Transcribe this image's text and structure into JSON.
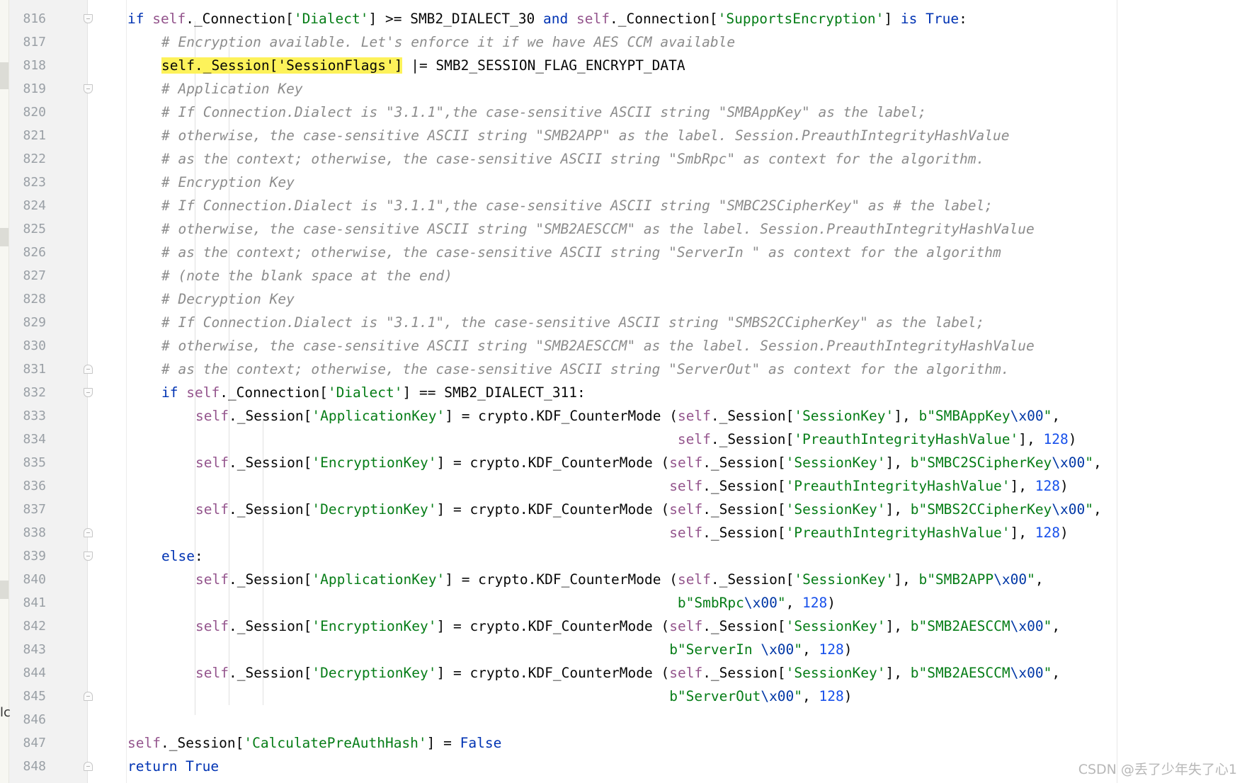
{
  "editor": {
    "watermark": "CSDN @丢了少年失了心1",
    "cut_text": "lc",
    "lines": [
      {
        "num": "816",
        "fold": "open",
        "indent": 1,
        "segs": [
          {
            "t": "kw",
            "v": "if "
          },
          {
            "t": "self",
            "v": "self"
          },
          {
            "t": "pl",
            "v": "._Connection["
          },
          {
            "t": "str",
            "v": "'Dialect'"
          },
          {
            "t": "pl",
            "v": "] >= SMB2_DIALECT_30 "
          },
          {
            "t": "kw",
            "v": "and "
          },
          {
            "t": "self",
            "v": "self"
          },
          {
            "t": "pl",
            "v": "._Connection["
          },
          {
            "t": "str",
            "v": "'SupportsEncryption'"
          },
          {
            "t": "pl",
            "v": "] "
          },
          {
            "t": "kw",
            "v": "is True"
          },
          {
            "t": "pl",
            "v": ":"
          }
        ]
      },
      {
        "num": "817",
        "fold": "",
        "indent": 2,
        "segs": [
          {
            "t": "cm",
            "v": "# Encryption available. Let's enforce it if we have AES CCM available"
          }
        ]
      },
      {
        "num": "818",
        "fold": "",
        "indent": 2,
        "segs": [
          {
            "t": "hl",
            "v": "self._Session['SessionFlags']"
          },
          {
            "t": "pl",
            "v": " |= SMB2_SESSION_FLAG_ENCRYPT_DATA"
          }
        ]
      },
      {
        "num": "819",
        "fold": "open",
        "indent": 2,
        "segs": [
          {
            "t": "cm",
            "v": "# Application Key"
          }
        ]
      },
      {
        "num": "820",
        "fold": "",
        "indent": 2,
        "segs": [
          {
            "t": "cm",
            "v": "# If Connection.Dialect is \"3.1.1\",the case-sensitive ASCII string \"SMBAppKey\" as the label;"
          }
        ]
      },
      {
        "num": "821",
        "fold": "",
        "indent": 2,
        "segs": [
          {
            "t": "cm",
            "v": "# otherwise, the case-sensitive ASCII string \"SMB2APP\" as the label. Session.PreauthIntegrityHashValue"
          }
        ]
      },
      {
        "num": "822",
        "fold": "",
        "indent": 2,
        "segs": [
          {
            "t": "cm",
            "v": "# as the context; otherwise, the case-sensitive ASCII string \"SmbRpc\" as context for the algorithm."
          }
        ]
      },
      {
        "num": "823",
        "fold": "",
        "indent": 2,
        "segs": [
          {
            "t": "cm",
            "v": "# Encryption Key"
          }
        ]
      },
      {
        "num": "824",
        "fold": "",
        "indent": 2,
        "segs": [
          {
            "t": "cm",
            "v": "# If Connection.Dialect is \"3.1.1\",the case-sensitive ASCII string \"SMBC2SCipherKey\" as # the label;"
          }
        ]
      },
      {
        "num": "825",
        "fold": "",
        "indent": 2,
        "segs": [
          {
            "t": "cm",
            "v": "# otherwise, the case-sensitive ASCII string \"SMB2AESCCM\" as the label. Session.PreauthIntegrityHashValue"
          }
        ]
      },
      {
        "num": "826",
        "fold": "",
        "indent": 2,
        "segs": [
          {
            "t": "cm",
            "v": "# as the context; otherwise, the case-sensitive ASCII string \"ServerIn \" as context for the algorithm"
          }
        ]
      },
      {
        "num": "827",
        "fold": "",
        "indent": 2,
        "segs": [
          {
            "t": "cm",
            "v": "# (note the blank space at the end)"
          }
        ]
      },
      {
        "num": "828",
        "fold": "",
        "indent": 2,
        "segs": [
          {
            "t": "cm",
            "v": "# Decryption Key"
          }
        ]
      },
      {
        "num": "829",
        "fold": "",
        "indent": 2,
        "segs": [
          {
            "t": "cm",
            "v": "# If Connection.Dialect is \"3.1.1\", the case-sensitive ASCII string \"SMBS2CCipherKey\" as the label;"
          }
        ]
      },
      {
        "num": "830",
        "fold": "",
        "indent": 2,
        "segs": [
          {
            "t": "cm",
            "v": "# otherwise, the case-sensitive ASCII string \"SMB2AESCCM\" as the label. Session.PreauthIntegrityHashValue"
          }
        ]
      },
      {
        "num": "831",
        "fold": "end",
        "indent": 2,
        "segs": [
          {
            "t": "cm",
            "v": "# as the context; otherwise, the case-sensitive ASCII string \"ServerOut\" as context for the algorithm."
          }
        ]
      },
      {
        "num": "832",
        "fold": "open",
        "indent": 2,
        "segs": [
          {
            "t": "kw",
            "v": "if "
          },
          {
            "t": "self",
            "v": "self"
          },
          {
            "t": "pl",
            "v": "._Connection["
          },
          {
            "t": "str",
            "v": "'Dialect'"
          },
          {
            "t": "pl",
            "v": "] == SMB2_DIALECT_311:"
          }
        ]
      },
      {
        "num": "833",
        "fold": "",
        "indent": 3,
        "segs": [
          {
            "t": "self",
            "v": "self"
          },
          {
            "t": "pl",
            "v": "._Session["
          },
          {
            "t": "str",
            "v": "'ApplicationKey'"
          },
          {
            "t": "pl",
            "v": "] = crypto.KDF_CounterMode ("
          },
          {
            "t": "self",
            "v": "self"
          },
          {
            "t": "pl",
            "v": "._Session["
          },
          {
            "t": "str",
            "v": "'SessionKey'"
          },
          {
            "t": "pl",
            "v": "], "
          },
          {
            "t": "str",
            "v": "b\"SMBAppKey"
          },
          {
            "t": "esc",
            "v": "\\x00"
          },
          {
            "t": "str",
            "v": "\""
          },
          {
            "t": "pl",
            "v": ","
          }
        ]
      },
      {
        "num": "834",
        "fold": "",
        "indent": 3,
        "segs": [
          {
            "t": "pl",
            "v": "                                                          "
          },
          {
            "t": "self",
            "v": "self"
          },
          {
            "t": "pl",
            "v": "._Session["
          },
          {
            "t": "str",
            "v": "'PreauthIntegrityHashValue'"
          },
          {
            "t": "pl",
            "v": "], "
          },
          {
            "t": "num",
            "v": "128"
          },
          {
            "t": "pl",
            "v": ")"
          }
        ]
      },
      {
        "num": "835",
        "fold": "",
        "indent": 3,
        "segs": [
          {
            "t": "self",
            "v": "self"
          },
          {
            "t": "pl",
            "v": "._Session["
          },
          {
            "t": "str",
            "v": "'EncryptionKey'"
          },
          {
            "t": "pl",
            "v": "] = crypto.KDF_CounterMode ("
          },
          {
            "t": "self",
            "v": "self"
          },
          {
            "t": "pl",
            "v": "._Session["
          },
          {
            "t": "str",
            "v": "'SessionKey'"
          },
          {
            "t": "pl",
            "v": "], "
          },
          {
            "t": "str",
            "v": "b\"SMBC2SCipherKey"
          },
          {
            "t": "esc",
            "v": "\\x00"
          },
          {
            "t": "str",
            "v": "\""
          },
          {
            "t": "pl",
            "v": ","
          }
        ]
      },
      {
        "num": "836",
        "fold": "",
        "indent": 3,
        "segs": [
          {
            "t": "pl",
            "v": "                                                         "
          },
          {
            "t": "self",
            "v": "self"
          },
          {
            "t": "pl",
            "v": "._Session["
          },
          {
            "t": "str",
            "v": "'PreauthIntegrityHashValue'"
          },
          {
            "t": "pl",
            "v": "], "
          },
          {
            "t": "num",
            "v": "128"
          },
          {
            "t": "pl",
            "v": ")"
          }
        ]
      },
      {
        "num": "837",
        "fold": "",
        "indent": 3,
        "segs": [
          {
            "t": "self",
            "v": "self"
          },
          {
            "t": "pl",
            "v": "._Session["
          },
          {
            "t": "str",
            "v": "'DecryptionKey'"
          },
          {
            "t": "pl",
            "v": "] = crypto.KDF_CounterMode ("
          },
          {
            "t": "self",
            "v": "self"
          },
          {
            "t": "pl",
            "v": "._Session["
          },
          {
            "t": "str",
            "v": "'SessionKey'"
          },
          {
            "t": "pl",
            "v": "], "
          },
          {
            "t": "str",
            "v": "b\"SMBS2CCipherKey"
          },
          {
            "t": "esc",
            "v": "\\x00"
          },
          {
            "t": "str",
            "v": "\""
          },
          {
            "t": "pl",
            "v": ","
          }
        ]
      },
      {
        "num": "838",
        "fold": "end",
        "indent": 3,
        "segs": [
          {
            "t": "pl",
            "v": "                                                         "
          },
          {
            "t": "self",
            "v": "self"
          },
          {
            "t": "pl",
            "v": "._Session["
          },
          {
            "t": "str",
            "v": "'PreauthIntegrityHashValue'"
          },
          {
            "t": "pl",
            "v": "], "
          },
          {
            "t": "num",
            "v": "128"
          },
          {
            "t": "pl",
            "v": ")"
          }
        ]
      },
      {
        "num": "839",
        "fold": "open",
        "indent": 2,
        "segs": [
          {
            "t": "kw",
            "v": "else"
          },
          {
            "t": "pl",
            "v": ":"
          }
        ]
      },
      {
        "num": "840",
        "fold": "",
        "indent": 3,
        "segs": [
          {
            "t": "self",
            "v": "self"
          },
          {
            "t": "pl",
            "v": "._Session["
          },
          {
            "t": "str",
            "v": "'ApplicationKey'"
          },
          {
            "t": "pl",
            "v": "] = crypto.KDF_CounterMode ("
          },
          {
            "t": "self",
            "v": "self"
          },
          {
            "t": "pl",
            "v": "._Session["
          },
          {
            "t": "str",
            "v": "'SessionKey'"
          },
          {
            "t": "pl",
            "v": "], "
          },
          {
            "t": "str",
            "v": "b\"SMB2APP"
          },
          {
            "t": "esc",
            "v": "\\x00"
          },
          {
            "t": "str",
            "v": "\""
          },
          {
            "t": "pl",
            "v": ","
          }
        ]
      },
      {
        "num": "841",
        "fold": "",
        "indent": 3,
        "segs": [
          {
            "t": "pl",
            "v": "                                                          "
          },
          {
            "t": "str",
            "v": "b\"SmbRpc"
          },
          {
            "t": "esc",
            "v": "\\x00"
          },
          {
            "t": "str",
            "v": "\""
          },
          {
            "t": "pl",
            "v": ", "
          },
          {
            "t": "num",
            "v": "128"
          },
          {
            "t": "pl",
            "v": ")"
          }
        ]
      },
      {
        "num": "842",
        "fold": "",
        "indent": 3,
        "segs": [
          {
            "t": "self",
            "v": "self"
          },
          {
            "t": "pl",
            "v": "._Session["
          },
          {
            "t": "str",
            "v": "'EncryptionKey'"
          },
          {
            "t": "pl",
            "v": "] = crypto.KDF_CounterMode ("
          },
          {
            "t": "self",
            "v": "self"
          },
          {
            "t": "pl",
            "v": "._Session["
          },
          {
            "t": "str",
            "v": "'SessionKey'"
          },
          {
            "t": "pl",
            "v": "], "
          },
          {
            "t": "str",
            "v": "b\"SMB2AESCCM"
          },
          {
            "t": "esc",
            "v": "\\x00"
          },
          {
            "t": "str",
            "v": "\""
          },
          {
            "t": "pl",
            "v": ","
          }
        ]
      },
      {
        "num": "843",
        "fold": "",
        "indent": 3,
        "segs": [
          {
            "t": "pl",
            "v": "                                                         "
          },
          {
            "t": "str",
            "v": "b\"ServerIn "
          },
          {
            "t": "esc",
            "v": "\\x00"
          },
          {
            "t": "str",
            "v": "\""
          },
          {
            "t": "pl",
            "v": ", "
          },
          {
            "t": "num",
            "v": "128"
          },
          {
            "t": "pl",
            "v": ")"
          }
        ]
      },
      {
        "num": "844",
        "fold": "",
        "indent": 3,
        "segs": [
          {
            "t": "self",
            "v": "self"
          },
          {
            "t": "pl",
            "v": "._Session["
          },
          {
            "t": "str",
            "v": "'DecryptionKey'"
          },
          {
            "t": "pl",
            "v": "] = crypto.KDF_CounterMode ("
          },
          {
            "t": "self",
            "v": "self"
          },
          {
            "t": "pl",
            "v": "._Session["
          },
          {
            "t": "str",
            "v": "'SessionKey'"
          },
          {
            "t": "pl",
            "v": "], "
          },
          {
            "t": "str",
            "v": "b\"SMB2AESCCM"
          },
          {
            "t": "esc",
            "v": "\\x00"
          },
          {
            "t": "str",
            "v": "\""
          },
          {
            "t": "pl",
            "v": ","
          }
        ]
      },
      {
        "num": "845",
        "fold": "end",
        "indent": 3,
        "segs": [
          {
            "t": "pl",
            "v": "                                                         "
          },
          {
            "t": "str",
            "v": "b\"ServerOut"
          },
          {
            "t": "esc",
            "v": "\\x00"
          },
          {
            "t": "str",
            "v": "\""
          },
          {
            "t": "pl",
            "v": ", "
          },
          {
            "t": "num",
            "v": "128"
          },
          {
            "t": "pl",
            "v": ")"
          }
        ]
      },
      {
        "num": "846",
        "fold": "",
        "indent": 0,
        "segs": []
      },
      {
        "num": "847",
        "fold": "",
        "indent": 1,
        "segs": [
          {
            "t": "self",
            "v": "self"
          },
          {
            "t": "pl",
            "v": "._Session["
          },
          {
            "t": "str",
            "v": "'CalculatePreAuthHash'"
          },
          {
            "t": "pl",
            "v": "] = "
          },
          {
            "t": "kw",
            "v": "False"
          }
        ]
      },
      {
        "num": "848",
        "fold": "end",
        "indent": 1,
        "segs": [
          {
            "t": "kw",
            "v": "return True"
          }
        ]
      }
    ]
  }
}
